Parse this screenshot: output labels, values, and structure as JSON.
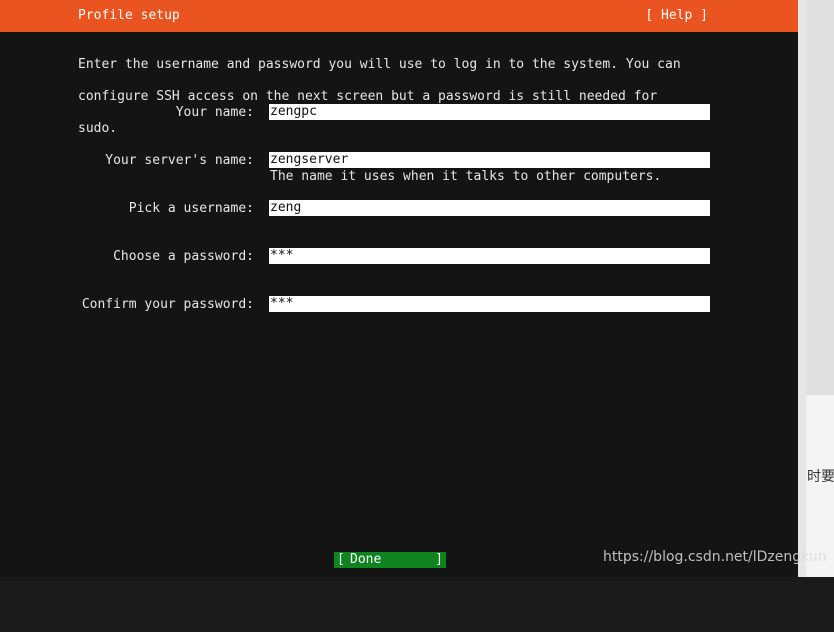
{
  "header": {
    "title": "Profile setup",
    "help_label": "[ Help ]",
    "accent_color": "#e95420"
  },
  "intro": {
    "line1": "Enter the username and password you will use to log in to the system. You can",
    "line2": "configure SSH access on the next screen but a password is still needed for",
    "line3": "sudo."
  },
  "fields": {
    "your_name": {
      "label": "Your name:",
      "value": "zengpc"
    },
    "server_name": {
      "label": "Your server's name:",
      "value": "zengserver",
      "hint": "The name it uses when it talks to other computers."
    },
    "username": {
      "label": "Pick a username:",
      "value": "zeng"
    },
    "password": {
      "label": "Choose a password:",
      "value": "***"
    },
    "confirm_password": {
      "label": "Confirm your password:",
      "value": "***"
    }
  },
  "footer": {
    "done_bracket_left": "[",
    "done_label": "Done",
    "done_bracket_right": "]",
    "done_color": "#0e8420"
  },
  "side": {
    "partial_text": "时要"
  },
  "watermark": "https://blog.csdn.net/lDzengkun"
}
